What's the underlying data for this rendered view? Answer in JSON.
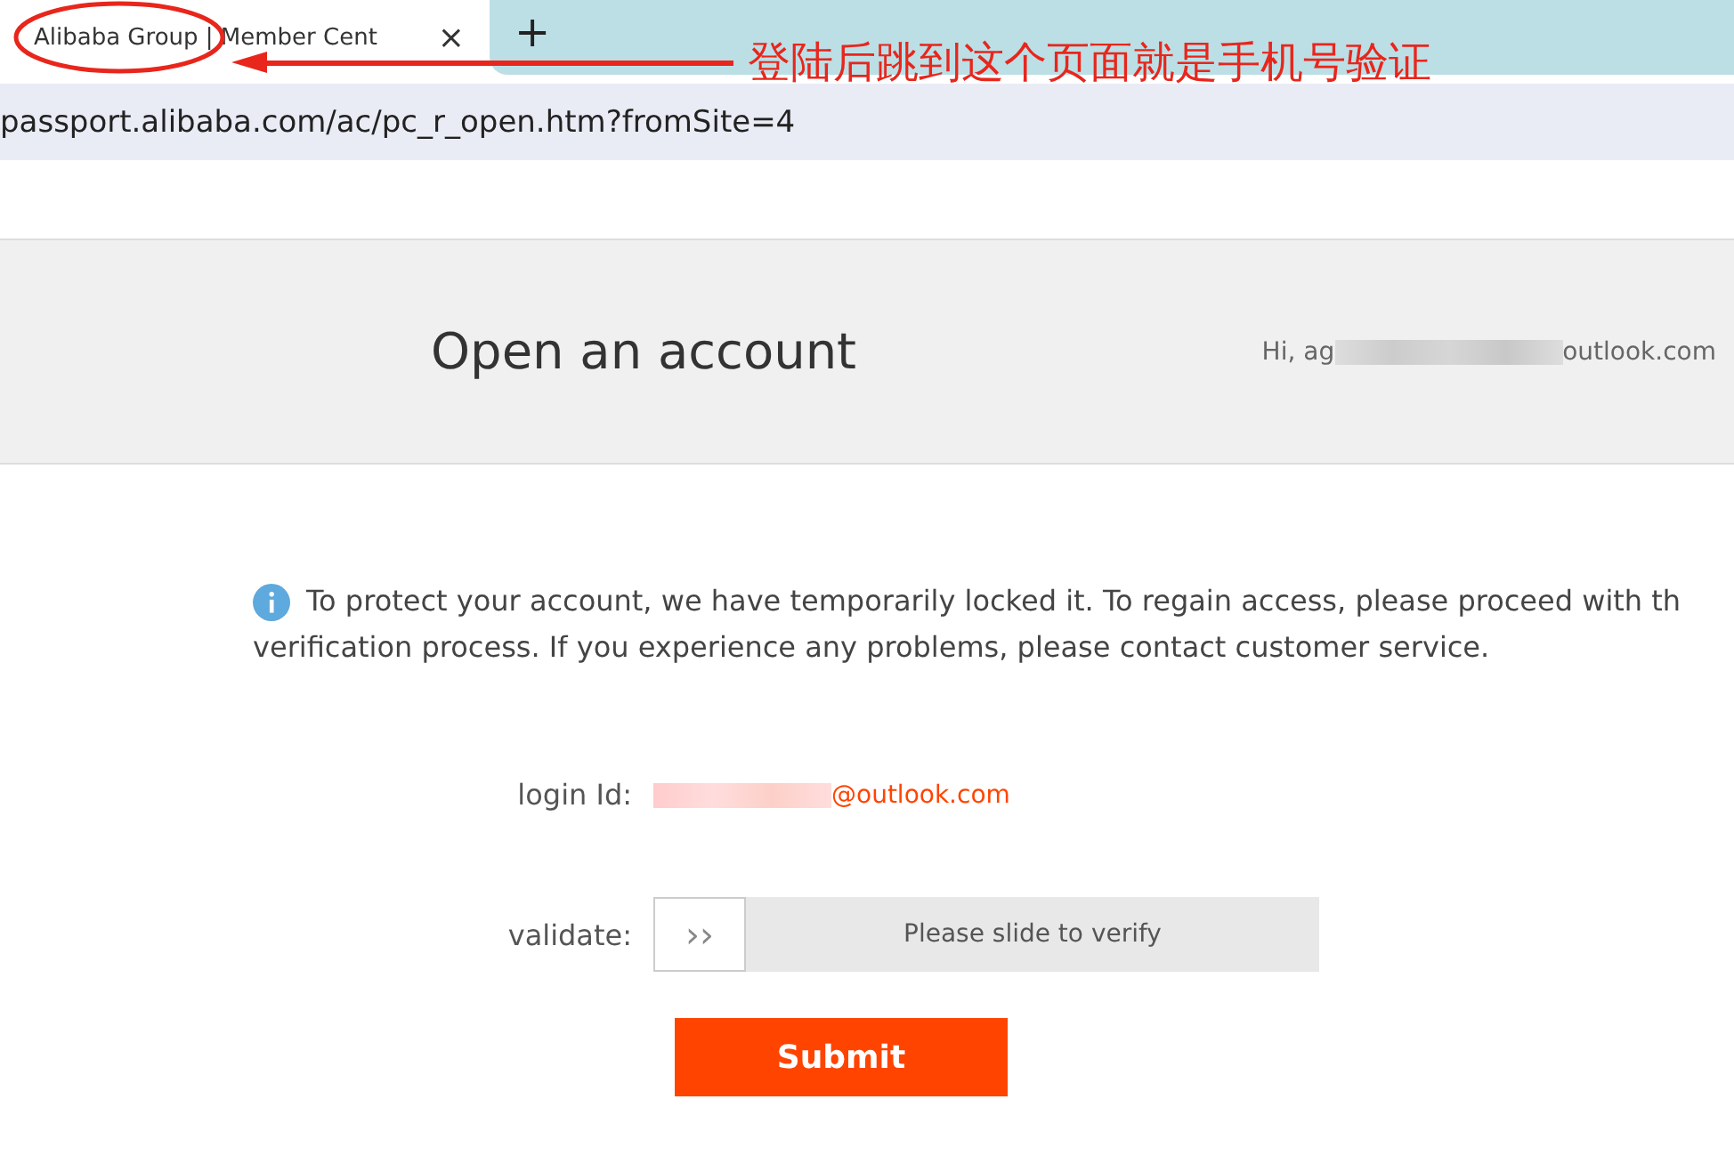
{
  "browser": {
    "tab_title": "Alibaba Group | Member Cent",
    "tab_close": "×",
    "new_tab": "+",
    "address": "passport.alibaba.com/ac/pc_r_open.htm?fromSite=4"
  },
  "header": {
    "title": "Open an account",
    "greeting_prefix": "Hi, ag",
    "greeting_suffix": "outlook.com"
  },
  "notice_lines": [
    "To protect your account, we have temporarily locked it. To regain access, please proceed with th",
    "verification process. If you experience any problems, please contact customer service."
  ],
  "form": {
    "login_label": "login Id:",
    "login_suffix": "@outlook.com",
    "validate_label": "validate:",
    "slider_handle": "››",
    "slider_text": "Please slide to verify",
    "submit": "Submit"
  },
  "annotation": {
    "text": "登陆后跳到这个页面就是手机号验证"
  }
}
